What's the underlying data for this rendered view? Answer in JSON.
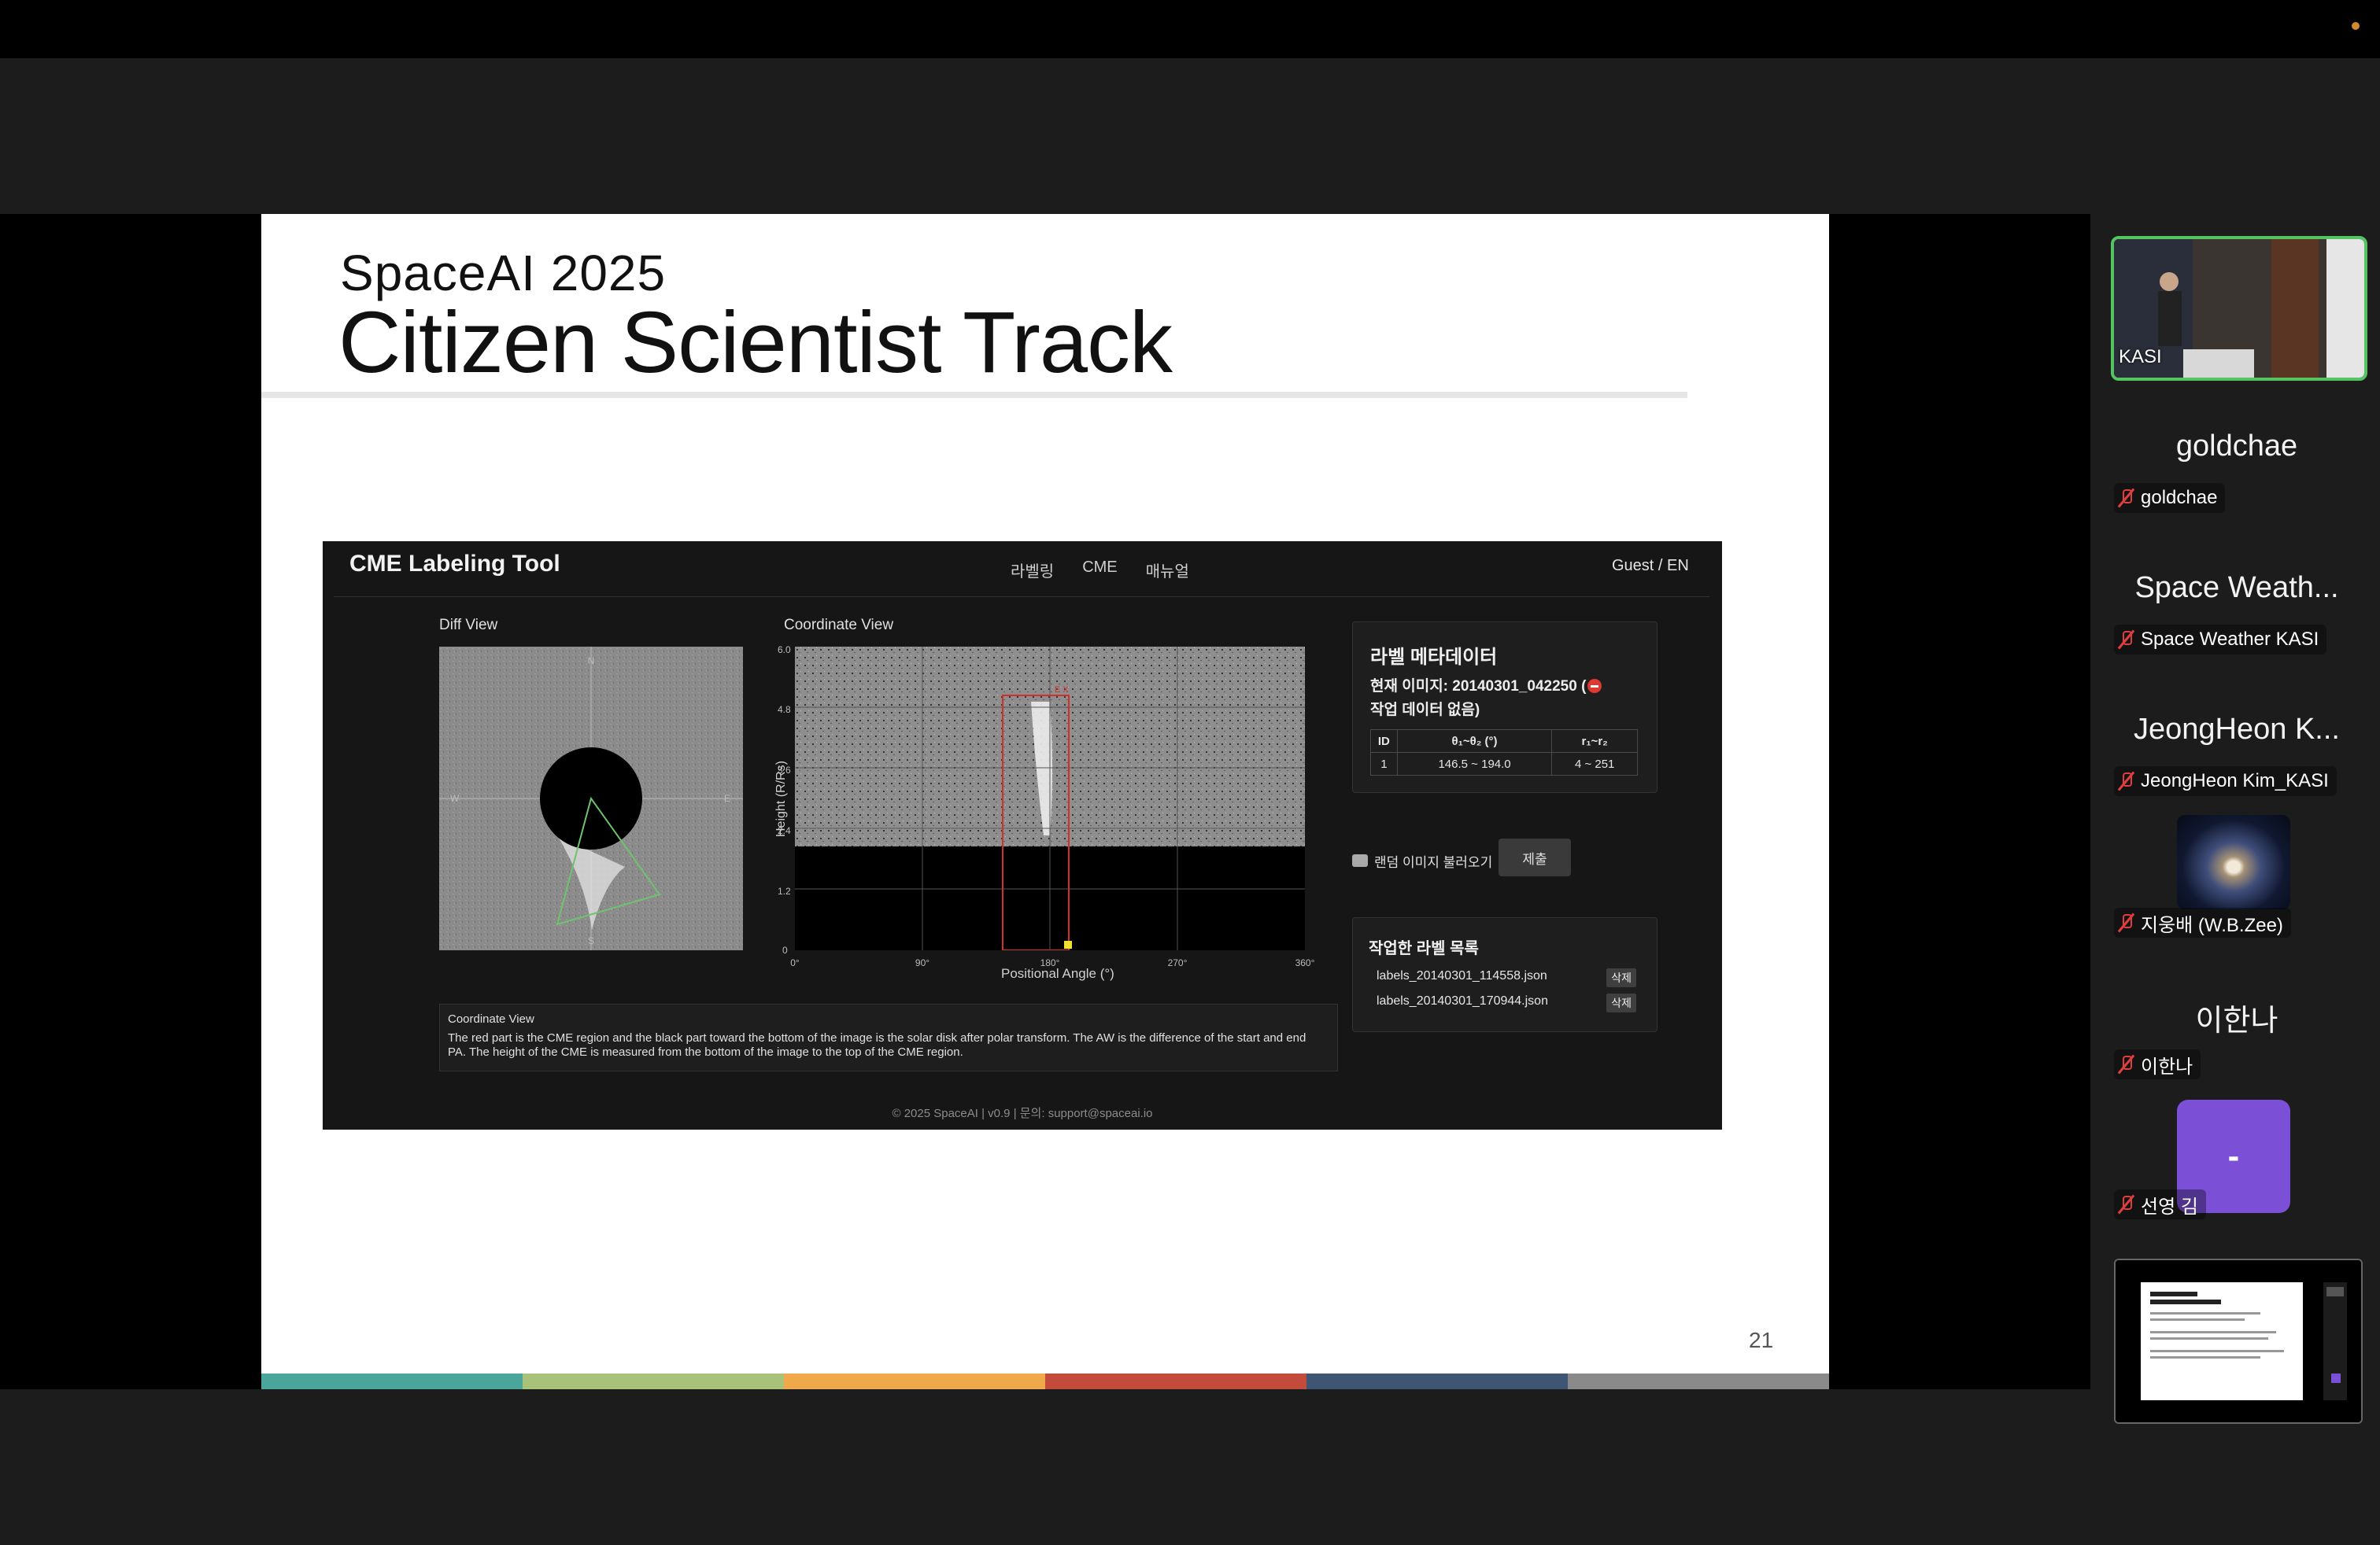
{
  "slide": {
    "kicker": "SpaceAI 2025",
    "title": "Citizen Scientist Track",
    "page_number": "21",
    "band_colors": [
      "#4aa59a",
      "#a8c27a",
      "#efa94a",
      "#c34b3b",
      "#3e5574",
      "#8a8a8a"
    ]
  },
  "tool": {
    "logo": "CME Labeling Tool",
    "nav": [
      "라벨링",
      "CME",
      "매뉴얼"
    ],
    "user": "Guest / EN",
    "diff_view_label": "Diff View",
    "diff_directions": {
      "n": "N",
      "w": "W",
      "e": "E",
      "s": "S"
    },
    "coord_view_label": "Coordinate View",
    "plot": {
      "y_ticks": [
        "6.0",
        "4.8",
        "3.6",
        "2.4",
        "1.2",
        "0"
      ],
      "x_ticks": [
        "0°",
        "90°",
        "180°",
        "270°",
        "360°"
      ],
      "ylabel": "Height (R/Rs)",
      "xlabel": "Positional Angle (°)",
      "box_marker": "E X",
      "region_color": "#d2302c"
    },
    "description": {
      "title": "Coordinate View",
      "text": "The red part is the CME region and the black part toward the bottom of the image is the solar disk after polar transform. The AW is the difference of the start and end PA. The height of the CME is measured from the bottom of the image to the top of the CME region."
    },
    "metadata": {
      "title": "라벨 메타데이터",
      "current_image": "현재 이미지: 20140301_042250 (",
      "status": "작업 데이터 없음)",
      "columns": [
        "ID",
        "θ₁~θ₂ (°)",
        "r₁~r₂"
      ],
      "rows": [
        [
          "1",
          "146.5 ~ 194.0",
          "4 ~ 251"
        ]
      ]
    },
    "random_button": "랜덤 이미지 불러오기",
    "submit_button": "제출",
    "labels_list": {
      "title": "작업한 라벨 목록",
      "items": [
        {
          "file": "labels_20140301_114558.json",
          "delete": "삭제"
        },
        {
          "file": "labels_20140301_170944.json",
          "delete": "삭제"
        }
      ]
    },
    "footer": "© 2025 SpaceAI | v0.9 | 문의: support@spaceai.io"
  },
  "participants": {
    "self_name": "KASI",
    "list": [
      {
        "display": "goldchae",
        "name": "goldchae"
      },
      {
        "display": "Space Weath...",
        "name": "Space Weather KASI"
      },
      {
        "display": "JeongHeon K...",
        "name": "JeongHeon Kim_KASI"
      },
      {
        "display": "",
        "name": "지웅배 (W.B.Zee)"
      },
      {
        "display": "이한나",
        "name": "이한나"
      },
      {
        "display": "-",
        "name": "선영 김"
      }
    ]
  },
  "colors": {
    "active_speaker_border": "#55c35f",
    "muted_icon": "#e03d3d",
    "avatar_purple": "#7b4fd6"
  }
}
